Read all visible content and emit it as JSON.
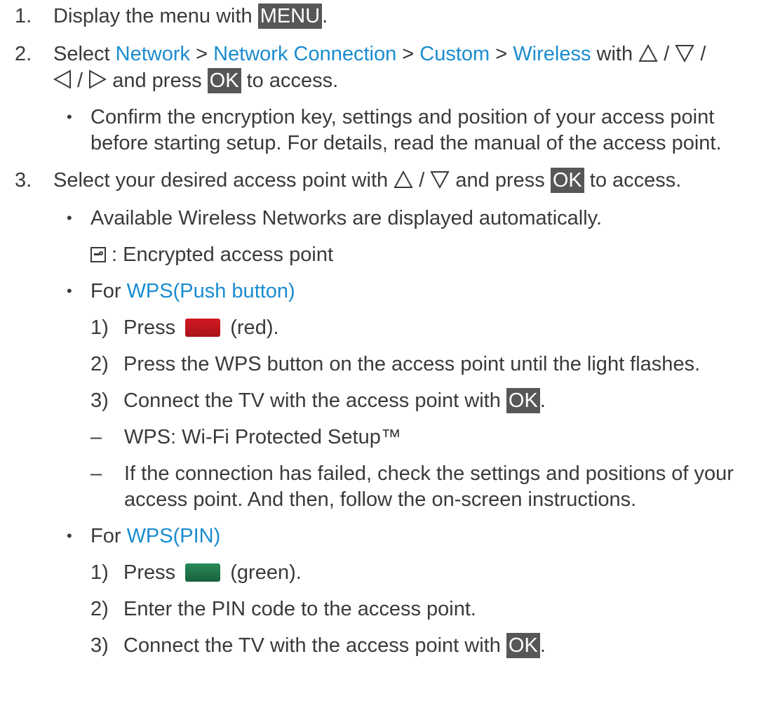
{
  "steps": {
    "s1": {
      "num": "1.",
      "text": "Display the menu with ",
      "key": "MENU",
      "end": "."
    },
    "s2": {
      "num": "2.",
      "select": "Select ",
      "menu_path": [
        "Network",
        "Network Connection",
        "Custom",
        "Wireless"
      ],
      "sep": " > ",
      "with": " with ",
      "slash": " / ",
      "press": " and press ",
      "key": "OK",
      "end": " to access."
    },
    "s2_note": {
      "line1": "Confirm the encryption key, settings and position of your access point",
      "line2": "before starting setup. For details, read the manual of the access point."
    },
    "s3": {
      "num": "3.",
      "text": "Select your desired access point with ",
      "slash": " / ",
      "press": " and press ",
      "key": "OK",
      "end": " to access."
    },
    "s3_note1": "Available Wireless Networks are displayed automatically.",
    "encrypted_label": " : Encrypted access point",
    "wps_push": {
      "for": "For ",
      "name": "WPS(Push button)",
      "sub1": {
        "num": "1)",
        "press": "Press ",
        "color_name": " (red).",
        "color": "#c0161b"
      },
      "sub2": {
        "num": "2)",
        "text": "Press the WPS button on the access point until the light flashes."
      },
      "sub3": {
        "num": "3)",
        "text": "Connect the TV with the access point with ",
        "key": "OK",
        "end": "."
      },
      "dash1": "WPS: Wi-Fi Protected Setup™",
      "dash2_line1": "If the connection has failed, check the settings and positions of your",
      "dash2_line2": "access point. And then, follow the on-screen instructions."
    },
    "wps_pin": {
      "for": "For ",
      "name": "WPS(PIN)",
      "sub1": {
        "num": "1)",
        "press": "Press ",
        "color_name": " (green).",
        "color": "#1f7a4c"
      },
      "sub2": {
        "num": "2)",
        "text": "Enter the PIN code to the access point."
      },
      "sub3": {
        "num": "3)",
        "text": "Connect the TV with the access point with ",
        "key": "OK",
        "end": "."
      }
    }
  },
  "symbols": {
    "bullet": "•",
    "dash": "–"
  }
}
